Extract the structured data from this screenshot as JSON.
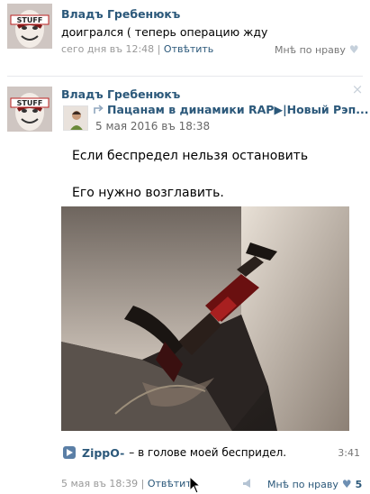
{
  "comment": {
    "author": "Владъ Гребенюкъ",
    "text": "доигрался ( теперь операцию жду",
    "time": "сего дня въ 12:48",
    "separator": "|",
    "reply_label": "Отвѣтить",
    "like_label": "Мнѣ по нраву",
    "avatar_badge": "STUFF"
  },
  "post": {
    "author": "Владъ Гребенюкъ",
    "avatar_badge": "STUFF",
    "close_icon": "×",
    "repost": {
      "source": "Пацанам в динамики RAP▶|Новый Рэп...",
      "date": "5 мая 2016 въ 18:38"
    },
    "text_line1": "Если беспредел нельзя остановить",
    "text_line2": "Его нужно возглавить.",
    "audio": {
      "artist": "ZippO-",
      "title": "– в голове моей беспридел.",
      "duration": "3:41"
    },
    "footer": {
      "time": "5 мая въ 18:39",
      "separator": "|",
      "reply_label": "Отвѣтить",
      "like_label": "Мнѣ по нраву",
      "like_count": "5"
    }
  },
  "colors": {
    "link": "#2b587a",
    "meta": "#999999",
    "divider": "#e7e8ec",
    "play_button": "#5b7fa6"
  },
  "icons": [
    "close-icon",
    "repost-arrow-icon",
    "play-icon",
    "heart-icon",
    "share-icon",
    "mouse-cursor-icon"
  ]
}
